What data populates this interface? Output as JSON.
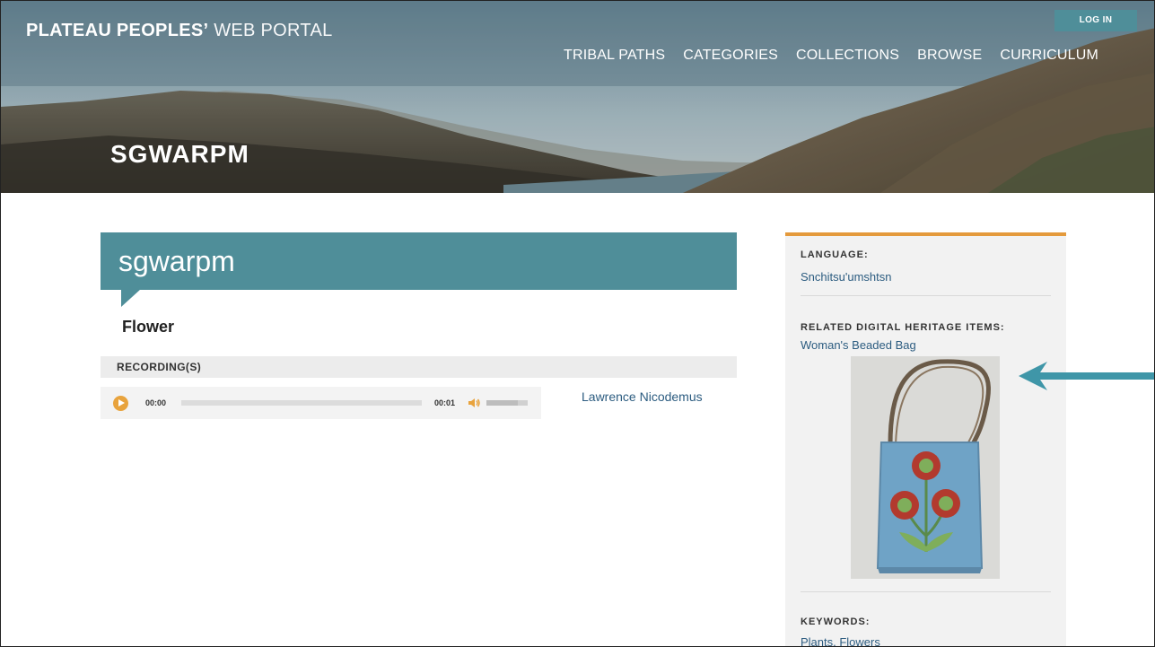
{
  "header": {
    "site_title_bold": "PLATEAU PEOPLES’",
    "site_title_light": " WEB PORTAL",
    "login_label": "LOG IN",
    "nav": [
      "TRIBAL PATHS",
      "CATEGORIES",
      "COLLECTIONS",
      "BROWSE",
      "CURRICULUM"
    ],
    "banner_title": "SGWARPM"
  },
  "main": {
    "title": "sgwarpm",
    "subtitle": "Flower",
    "recordings_header": "RECORDING(S)",
    "player": {
      "current_time": "00:00",
      "duration": "00:01",
      "progress": 0,
      "volume": 0.75
    },
    "recording_person": "Lawrence Nicodemus"
  },
  "sidebar": {
    "language_label": "LANGUAGE:",
    "language_value": "Snchitsu'umshtsn",
    "related_label": "RELATED DIGITAL HERITAGE ITEMS:",
    "related_value": "Woman's Beaded Bag",
    "keywords_label": "KEYWORDS:",
    "keywords_value": "Plants, Flowers"
  },
  "colors": {
    "accent_teal": "#4f8e99",
    "accent_orange": "#e49a3c",
    "link_blue": "#2c5c80"
  }
}
